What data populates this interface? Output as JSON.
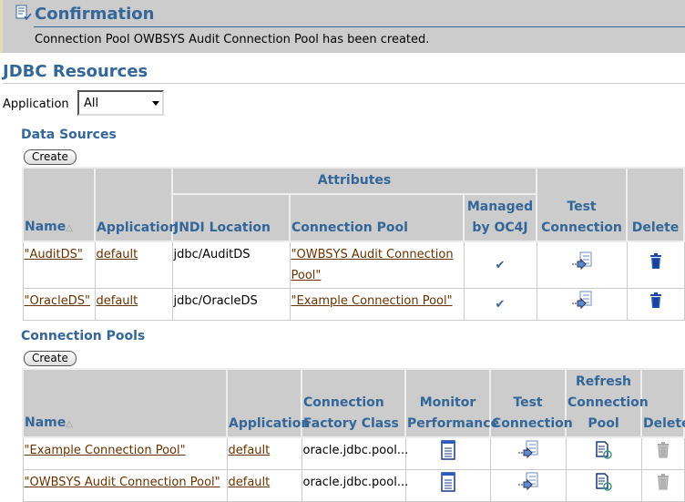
{
  "confirmation": {
    "title": "Confirmation",
    "message": "Connection Pool OWBSYS Audit Connection Pool has been created."
  },
  "page_title": "JDBC Resources",
  "filter": {
    "label": "Application",
    "value": "All"
  },
  "data_sources": {
    "title": "Data Sources",
    "create_label": "Create",
    "group_header": "Attributes",
    "columns": [
      "Name",
      "Application",
      "JNDI Location",
      "Connection Pool",
      "Managed by OC4J",
      "Test Connection",
      "Delete"
    ],
    "rows": [
      {
        "name": "\"AuditDS\"",
        "application": "default",
        "jndi": "jdbc/AuditDS",
        "pool": "\"OWBSYS Audit Connection Pool\"",
        "managed": true
      },
      {
        "name": "\"OracleDS\"",
        "application": "default",
        "jndi": "jdbc/OracleDS",
        "pool": "\"Example Connection Pool\"",
        "managed": true
      }
    ]
  },
  "connection_pools": {
    "title": "Connection Pools",
    "create_label": "Create",
    "columns": [
      "Name",
      "Application",
      "Connection Factory Class",
      "Monitor Performance",
      "Test Connection",
      "Refresh Connection Pool",
      "Delete"
    ],
    "rows": [
      {
        "name": "\"Example Connection Pool\"",
        "application": "default",
        "factory": "oracle.jdbc.pool..."
      },
      {
        "name": "\"OWBSYS Audit Connection Pool\"",
        "application": "default",
        "factory": "oracle.jdbc.pool..."
      }
    ]
  },
  "colors": {
    "header_blue": "#336699",
    "link": "#663300",
    "header_bg": "#cccccc"
  }
}
